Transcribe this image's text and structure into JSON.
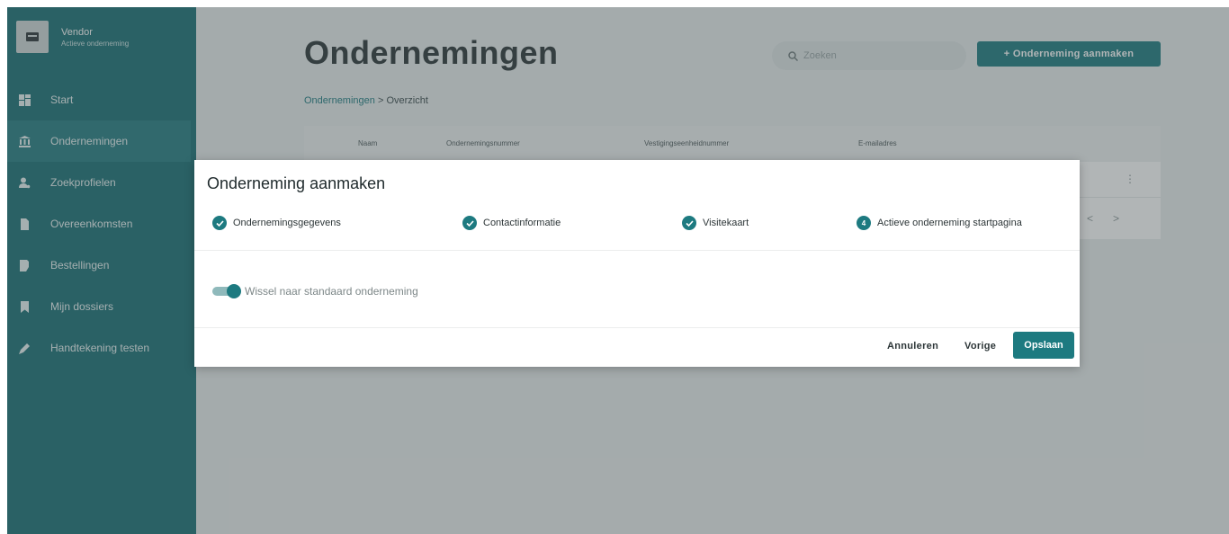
{
  "sidebar": {
    "brand": {
      "title": "Vendor",
      "subtitle": "Actieve onderneming",
      "icon": "card-icon"
    },
    "items": [
      {
        "label": "Start",
        "icon": "dashboard-icon"
      },
      {
        "label": "Ondernemingen",
        "icon": "bank-icon",
        "active": true
      },
      {
        "label": "Zoekprofielen",
        "icon": "user-search-icon"
      },
      {
        "label": "Overeenkomsten",
        "icon": "document-icon"
      },
      {
        "label": "Bestellingen",
        "icon": "order-icon"
      },
      {
        "label": "Mijn dossiers",
        "icon": "bookmark-icon"
      },
      {
        "label": "Handtekening testen",
        "icon": "pen-icon"
      }
    ]
  },
  "header": {
    "title": "Ondernemingen",
    "breadcrumb": {
      "link": "Ondernemingen",
      "separator": ">",
      "current": "Overzicht"
    },
    "search_placeholder": "Zoeken",
    "create_button": "+ Onderneming aanmaken"
  },
  "table": {
    "columns": [
      "Naam",
      "Ondernemingsnummer",
      "Vestigingseenheidnummer",
      "E-mailadres"
    ],
    "row_menu_icon": "kebab-icon",
    "pager": [
      "<",
      ">"
    ]
  },
  "modal": {
    "title": "Onderneming aanmaken",
    "steps": [
      {
        "label": "Ondernemingsgegevens",
        "state": "done"
      },
      {
        "label": "Contactinformatie",
        "state": "done"
      },
      {
        "label": "Visitekaart",
        "state": "done"
      },
      {
        "label": "Actieve onderneming startpagina",
        "state": "active",
        "number": "4"
      }
    ],
    "toggle": {
      "label": "Wissel naar standaard onderneming",
      "on": true
    },
    "buttons": {
      "cancel": "Annuleren",
      "previous": "Vorige",
      "save": "Opslaan"
    }
  },
  "colors": {
    "primary": "#1d7a80",
    "sidebar": "#186f74"
  }
}
